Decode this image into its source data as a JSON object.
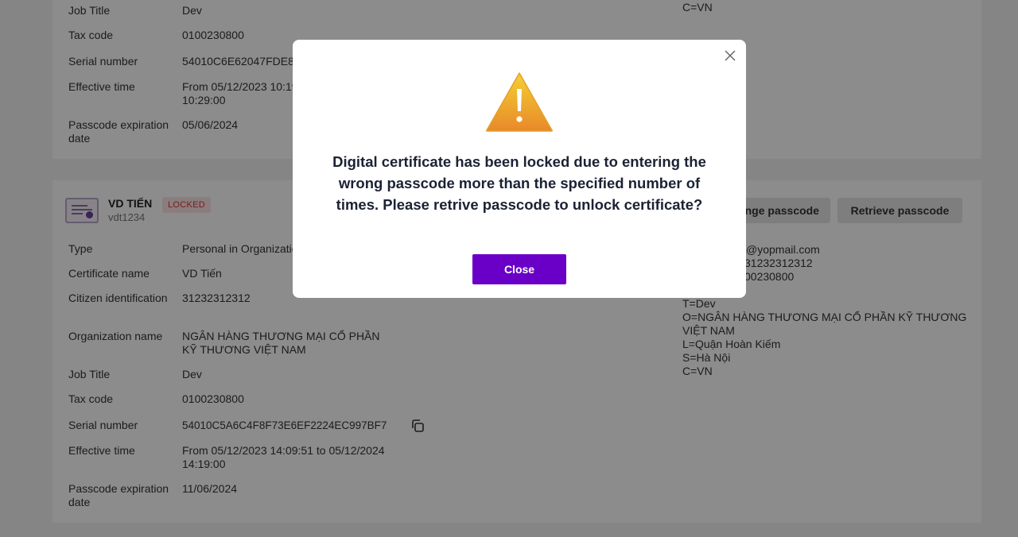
{
  "cert1": {
    "rows": [
      {
        "label": "Job Title",
        "value": "Dev"
      },
      {
        "label": "Tax code",
        "value": "0100230800"
      },
      {
        "label": "Serial number",
        "value": "54010C6E62047FDE8"
      },
      {
        "label": "Effective time",
        "value": "From 05/12/2023 10:19\n10:29:00"
      },
      {
        "label": "Passcode expiration date",
        "value": "05/06/2024"
      }
    ],
    "right_lines": [
      "C=VN"
    ]
  },
  "cert2": {
    "name": "VD TIẾN",
    "username": "vdt1234",
    "status": "LOCKED",
    "change_passcode_label": "nge passcode",
    "retrieve_passcode_label": "Retrieve passcode",
    "rows": [
      {
        "label": "Type",
        "value": "Personal in Organizatio"
      },
      {
        "label": "Certificate name",
        "value": "VD Tiến"
      },
      {
        "label": "Citizen identification",
        "value": "31232312312"
      },
      {
        "label": "Organization name",
        "value": "NGÂN HÀNG THƯƠNG MẠI CỔ PHẦN KỸ THƯƠNG VIỆT NAM"
      },
      {
        "label": "Job Title",
        "value": "Dev"
      },
      {
        "label": "Tax code",
        "value": "0100230800"
      },
      {
        "label": "Serial number",
        "value": "54010C5A6C4F8F73E6EF2224EC997BF7"
      },
      {
        "label": "Effective time",
        "value": "From 05/12/2023 14:09:51 to 05/12/2024 14:19:00"
      },
      {
        "label": "Passcode expiration date",
        "value": "11/06/2024"
      }
    ],
    "right_lines": [
      "@yopmail.com",
      "31232312312",
      "00230800",
      "",
      "T=Dev",
      "O=NGÂN HÀNG THƯƠNG MẠI CỔ PHẦN KỸ THƯƠNG",
      "VIỆT NAM",
      "L=Quận Hoàn Kiếm",
      "S=Hà Nội",
      "C=VN"
    ]
  },
  "modal": {
    "message": "Digital certificate has been locked due to entering the wrong passcode more than the specified number of times. Please retrive passcode to unlock certificate?",
    "close_label": "Close"
  },
  "icons": {
    "warning": "warning-icon",
    "close": "close-icon",
    "copy": "copy-icon",
    "certificate": "certificate-icon"
  },
  "colors": {
    "primary": "#6a00c8",
    "locked_bg": "#fde4e4",
    "locked_text": "#d9363e",
    "warning_top": "#f4c430",
    "warning_bottom": "#e8892a"
  }
}
